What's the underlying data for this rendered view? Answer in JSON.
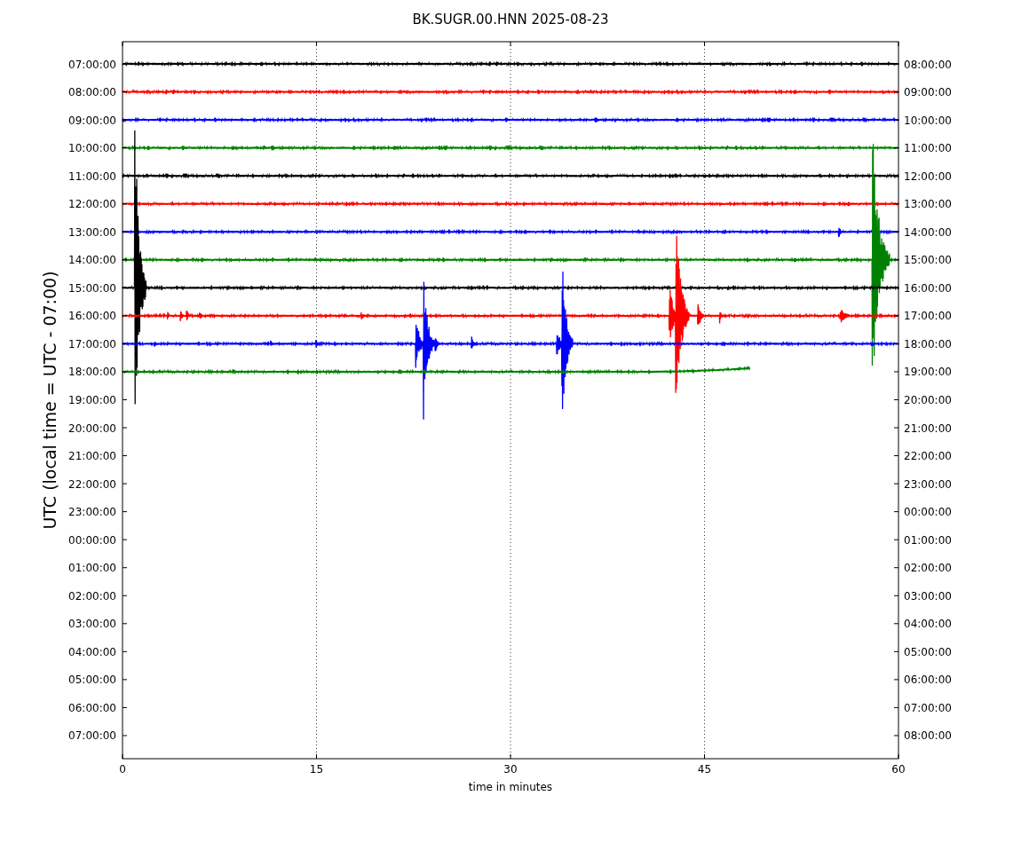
{
  "title": "BK.SUGR.00.HNN 2025-08-23",
  "ylabel": "UTC (local time = UTC - 07:00)",
  "xlabel": "time in minutes",
  "xticks": [
    "0",
    "15",
    "30",
    "45",
    "60"
  ],
  "left_ticks": [
    "07:00:00",
    "08:00:00",
    "09:00:00",
    "10:00:00",
    "11:00:00",
    "12:00:00",
    "13:00:00",
    "14:00:00",
    "15:00:00",
    "16:00:00",
    "17:00:00",
    "18:00:00",
    "19:00:00",
    "20:00:00",
    "21:00:00",
    "22:00:00",
    "23:00:00",
    "00:00:00",
    "01:00:00",
    "02:00:00",
    "03:00:00",
    "04:00:00",
    "05:00:00",
    "06:00:00",
    "07:00:00"
  ],
  "right_ticks": [
    "08:00:00",
    "09:00:00",
    "10:00:00",
    "11:00:00",
    "12:00:00",
    "13:00:00",
    "14:00:00",
    "15:00:00",
    "16:00:00",
    "17:00:00",
    "18:00:00",
    "19:00:00",
    "20:00:00",
    "21:00:00",
    "22:00:00",
    "23:00:00",
    "00:00:00",
    "01:00:00",
    "02:00:00",
    "03:00:00",
    "04:00:00",
    "05:00:00",
    "06:00:00",
    "07:00:00",
    "08:00:00"
  ],
  "traces": [
    {
      "color": "#000000"
    },
    {
      "color": "#ff0000"
    },
    {
      "color": "#0000ff"
    },
    {
      "color": "#008000"
    },
    {
      "color": "#000000"
    },
    {
      "color": "#ff0000"
    },
    {
      "color": "#0000ff"
    },
    {
      "color": "#008000"
    },
    {
      "color": "#000000"
    },
    {
      "color": "#ff0000"
    },
    {
      "color": "#0000ff"
    },
    {
      "color": "#008000"
    }
  ]
}
